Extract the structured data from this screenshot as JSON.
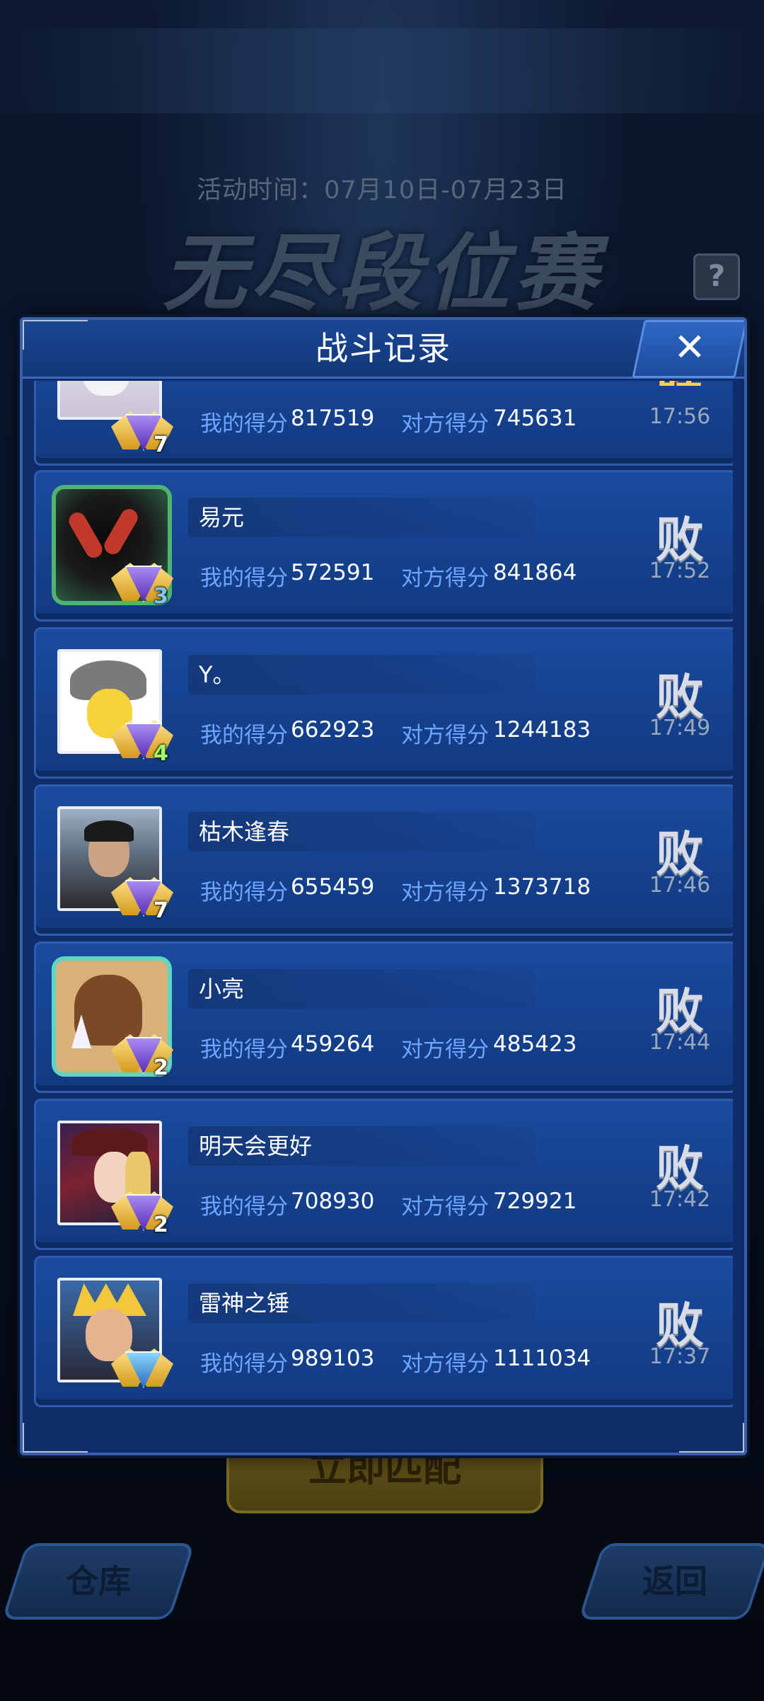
{
  "background": {
    "event_time": "活动时间：07月10日-07月23日",
    "event_title": "无尽段位赛",
    "help_label": "?",
    "match_button": "立即匹配",
    "storage_button": "仓库",
    "back_button": "返回"
  },
  "modal": {
    "title": "战斗记录",
    "close_label": "✕"
  },
  "labels": {
    "my_score": "我的得分",
    "opponent_score": "对方得分"
  },
  "colors": {
    "panel": "#0f2d6b",
    "card": "#1b4b9f",
    "score_label": "#6ea6ff",
    "win": "#ffd24a",
    "loss": "#d7dce6"
  },
  "records": [
    {
      "name": "",
      "my_score": "817519",
      "opponent_score": "745631",
      "result": "胜",
      "time": "17:56",
      "rank_level": "7",
      "avatar": "white-hair-portrait"
    },
    {
      "name": "易元",
      "my_score": "572591",
      "opponent_score": "841864",
      "result": "败",
      "time": "17:52",
      "rank_level": "3",
      "avatar": "chopsticks-sushi-frame"
    },
    {
      "name": "Y。",
      "my_score": "662923",
      "opponent_score": "1244183",
      "result": "败",
      "time": "17:49",
      "rank_level": "4",
      "avatar": "cartoon-duck"
    },
    {
      "name": "枯木逢春",
      "my_score": "655459",
      "opponent_score": "1373718",
      "result": "败",
      "time": "17:46",
      "rank_level": "7",
      "avatar": "man-portrait"
    },
    {
      "name": "小亮",
      "my_score": "459264",
      "opponent_score": "485423",
      "result": "败",
      "time": "17:44",
      "rank_level": "2",
      "avatar": "horse-cartoon-frame"
    },
    {
      "name": "明天会更好",
      "my_score": "708930",
      "opponent_score": "729921",
      "result": "败",
      "time": "17:42",
      "rank_level": "2",
      "avatar": "pirate-girl"
    },
    {
      "name": "雷神之锤",
      "my_score": "989103",
      "opponent_score": "1111034",
      "result": "败",
      "time": "17:37",
      "rank_level": "",
      "avatar": "blonde-hero"
    }
  ]
}
